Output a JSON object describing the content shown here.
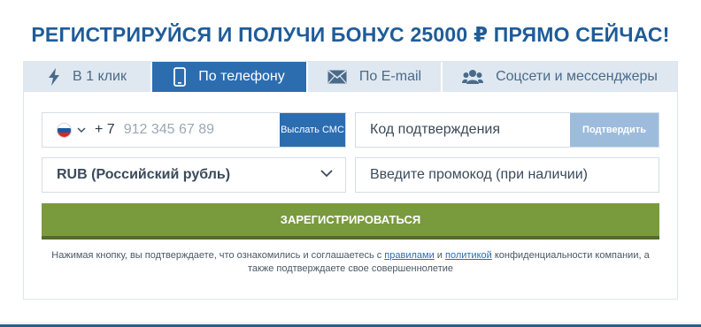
{
  "headline": "РЕГИСТРИРУЙСЯ И ПОЛУЧИ БОНУС 25000 ₽ ПРЯМО СЕЙЧАС!",
  "tabs": [
    {
      "label": "В 1 клик",
      "icon": "lightning-icon",
      "active": false
    },
    {
      "label": "По телефону",
      "icon": "phone-icon",
      "active": true
    },
    {
      "label": "По E-mail",
      "icon": "envelope-icon",
      "active": false
    },
    {
      "label": "Соцсети и мессенджеры",
      "icon": "users-icon",
      "active": false
    }
  ],
  "phone": {
    "country_icon": "russia-flag-icon",
    "code": "+ 7",
    "placeholder": "912 345 67 89",
    "value": "",
    "sms_button": "Выслать СМС"
  },
  "confirmation": {
    "placeholder": "Код подтверждения",
    "value": "",
    "button": "Подтвердить"
  },
  "currency": {
    "selected": "RUB (Российский рубль)"
  },
  "promo": {
    "placeholder": "Введите промокод (при наличии)",
    "value": ""
  },
  "register_button": "ЗАРЕГИСТРИРОВАТЬСЯ",
  "disclaimer": {
    "part1": "Нажимая кнопку, вы подтверждаете, что ознакомились и соглашаетесь с ",
    "link_rules": "правилами",
    "part2": " и ",
    "link_policy": "политикой",
    "part3": " конфиденциальности компании, а также подтверждаете свое совершеннолетие"
  },
  "colors": {
    "brand_blue": "#2c6db0",
    "headline_blue": "#1f5c99",
    "register_green": "#7a9a3e",
    "tab_inactive": "#dfe8f0",
    "confirm_disabled": "#9dbcdc"
  }
}
